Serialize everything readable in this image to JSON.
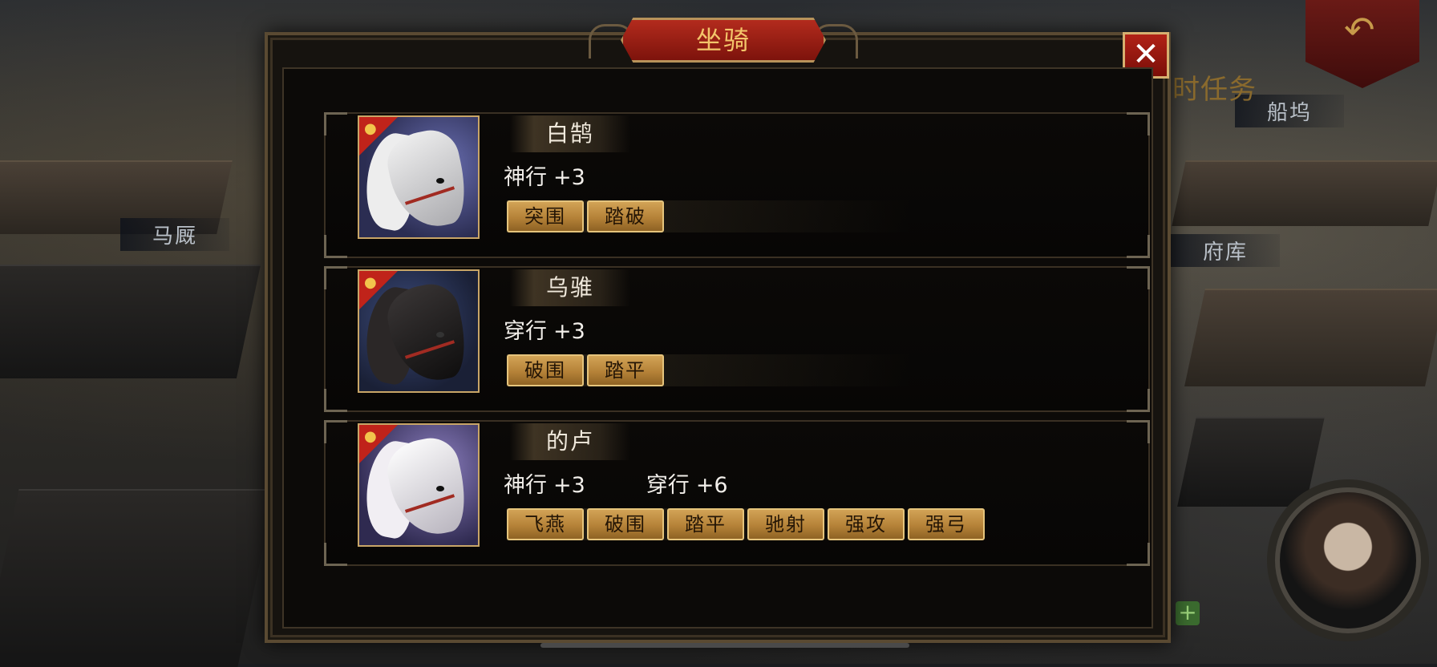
{
  "background": {
    "labels": {
      "stable": "马厩",
      "dock": "船坞",
      "treasury": "府库",
      "quest_fragment": "时任务"
    }
  },
  "dialog": {
    "title": "坐骑",
    "close_label": "✕"
  },
  "mounts": [
    {
      "name": "白鹄",
      "stats": [
        {
          "label": "神行",
          "value": "+3"
        }
      ],
      "skills": [
        "突围",
        "踏破"
      ],
      "portrait_colors": {
        "bg": "#3b3f6a",
        "coat": "#d8d8d8",
        "mane": "#ececec"
      }
    },
    {
      "name": "乌骓",
      "stats": [
        {
          "label": "穿行",
          "value": "+3"
        }
      ],
      "skills": [
        "破围",
        "踏平"
      ],
      "portrait_colors": {
        "bg": "#2a3350",
        "coat": "#1c1a1a",
        "mane": "#2a2626"
      }
    },
    {
      "name": "的卢",
      "stats": [
        {
          "label": "神行",
          "value": "+3"
        },
        {
          "label": "穿行",
          "value": "+6"
        }
      ],
      "skills": [
        "飞燕",
        "破围",
        "踏平",
        "驰射",
        "强攻",
        "强弓"
      ],
      "portrait_colors": {
        "bg": "#4b4470",
        "coat": "#e6e3e8",
        "mane": "#f1eef3"
      }
    }
  ],
  "colors": {
    "title_red": "#9f2016",
    "title_gold": "#f3c56a",
    "skill_gold": "#c4913f",
    "role_tag_red": "#c0231a"
  }
}
